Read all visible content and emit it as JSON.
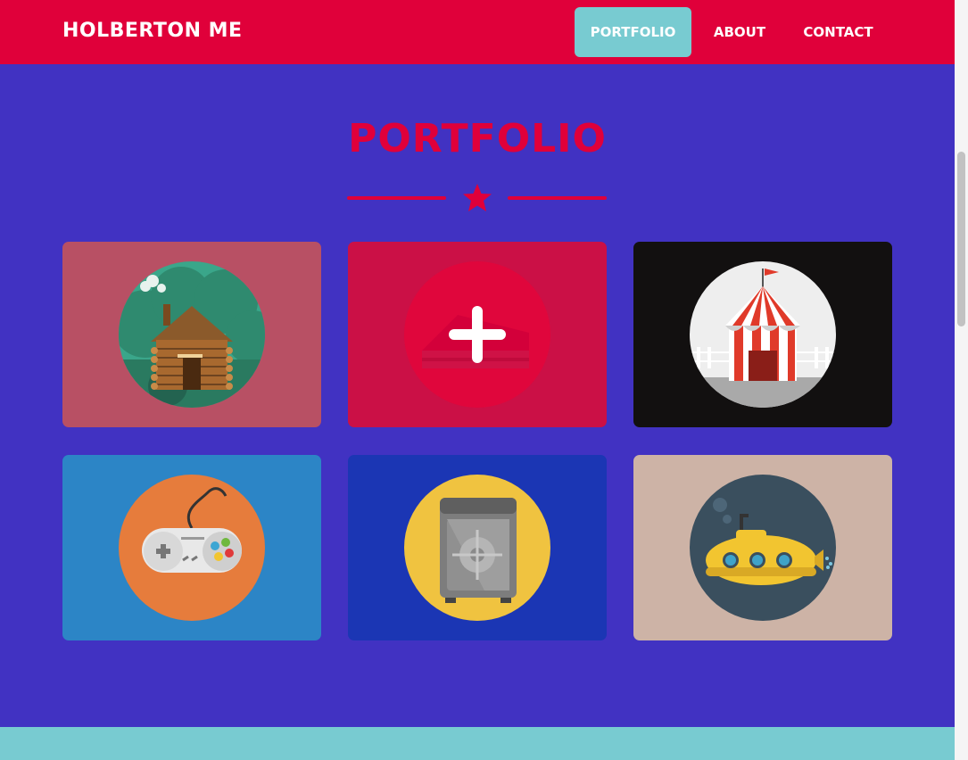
{
  "navbar": {
    "brand": "HOLBERTON ME",
    "items": [
      {
        "label": "PORTFOLIO",
        "active": true
      },
      {
        "label": "ABOUT",
        "active": false
      },
      {
        "label": "CONTACT",
        "active": false
      }
    ]
  },
  "portfolio": {
    "title": "PORTFOLIO",
    "tiles": [
      {
        "icon": "log-cabin-icon",
        "background": "#b85064"
      },
      {
        "icon": "cake-icon",
        "background": "#cb1046",
        "hovered": true
      },
      {
        "icon": "circus-tent-icon",
        "background": "#121010"
      },
      {
        "icon": "game-controller-icon",
        "background": "#2c85c6"
      },
      {
        "icon": "safe-icon",
        "background": "#1b36b4"
      },
      {
        "icon": "submarine-icon",
        "background": "#cdb3a6"
      }
    ]
  },
  "colors": {
    "primary": "#e0003a",
    "accent": "#78cbd1",
    "background": "#4132c2"
  }
}
